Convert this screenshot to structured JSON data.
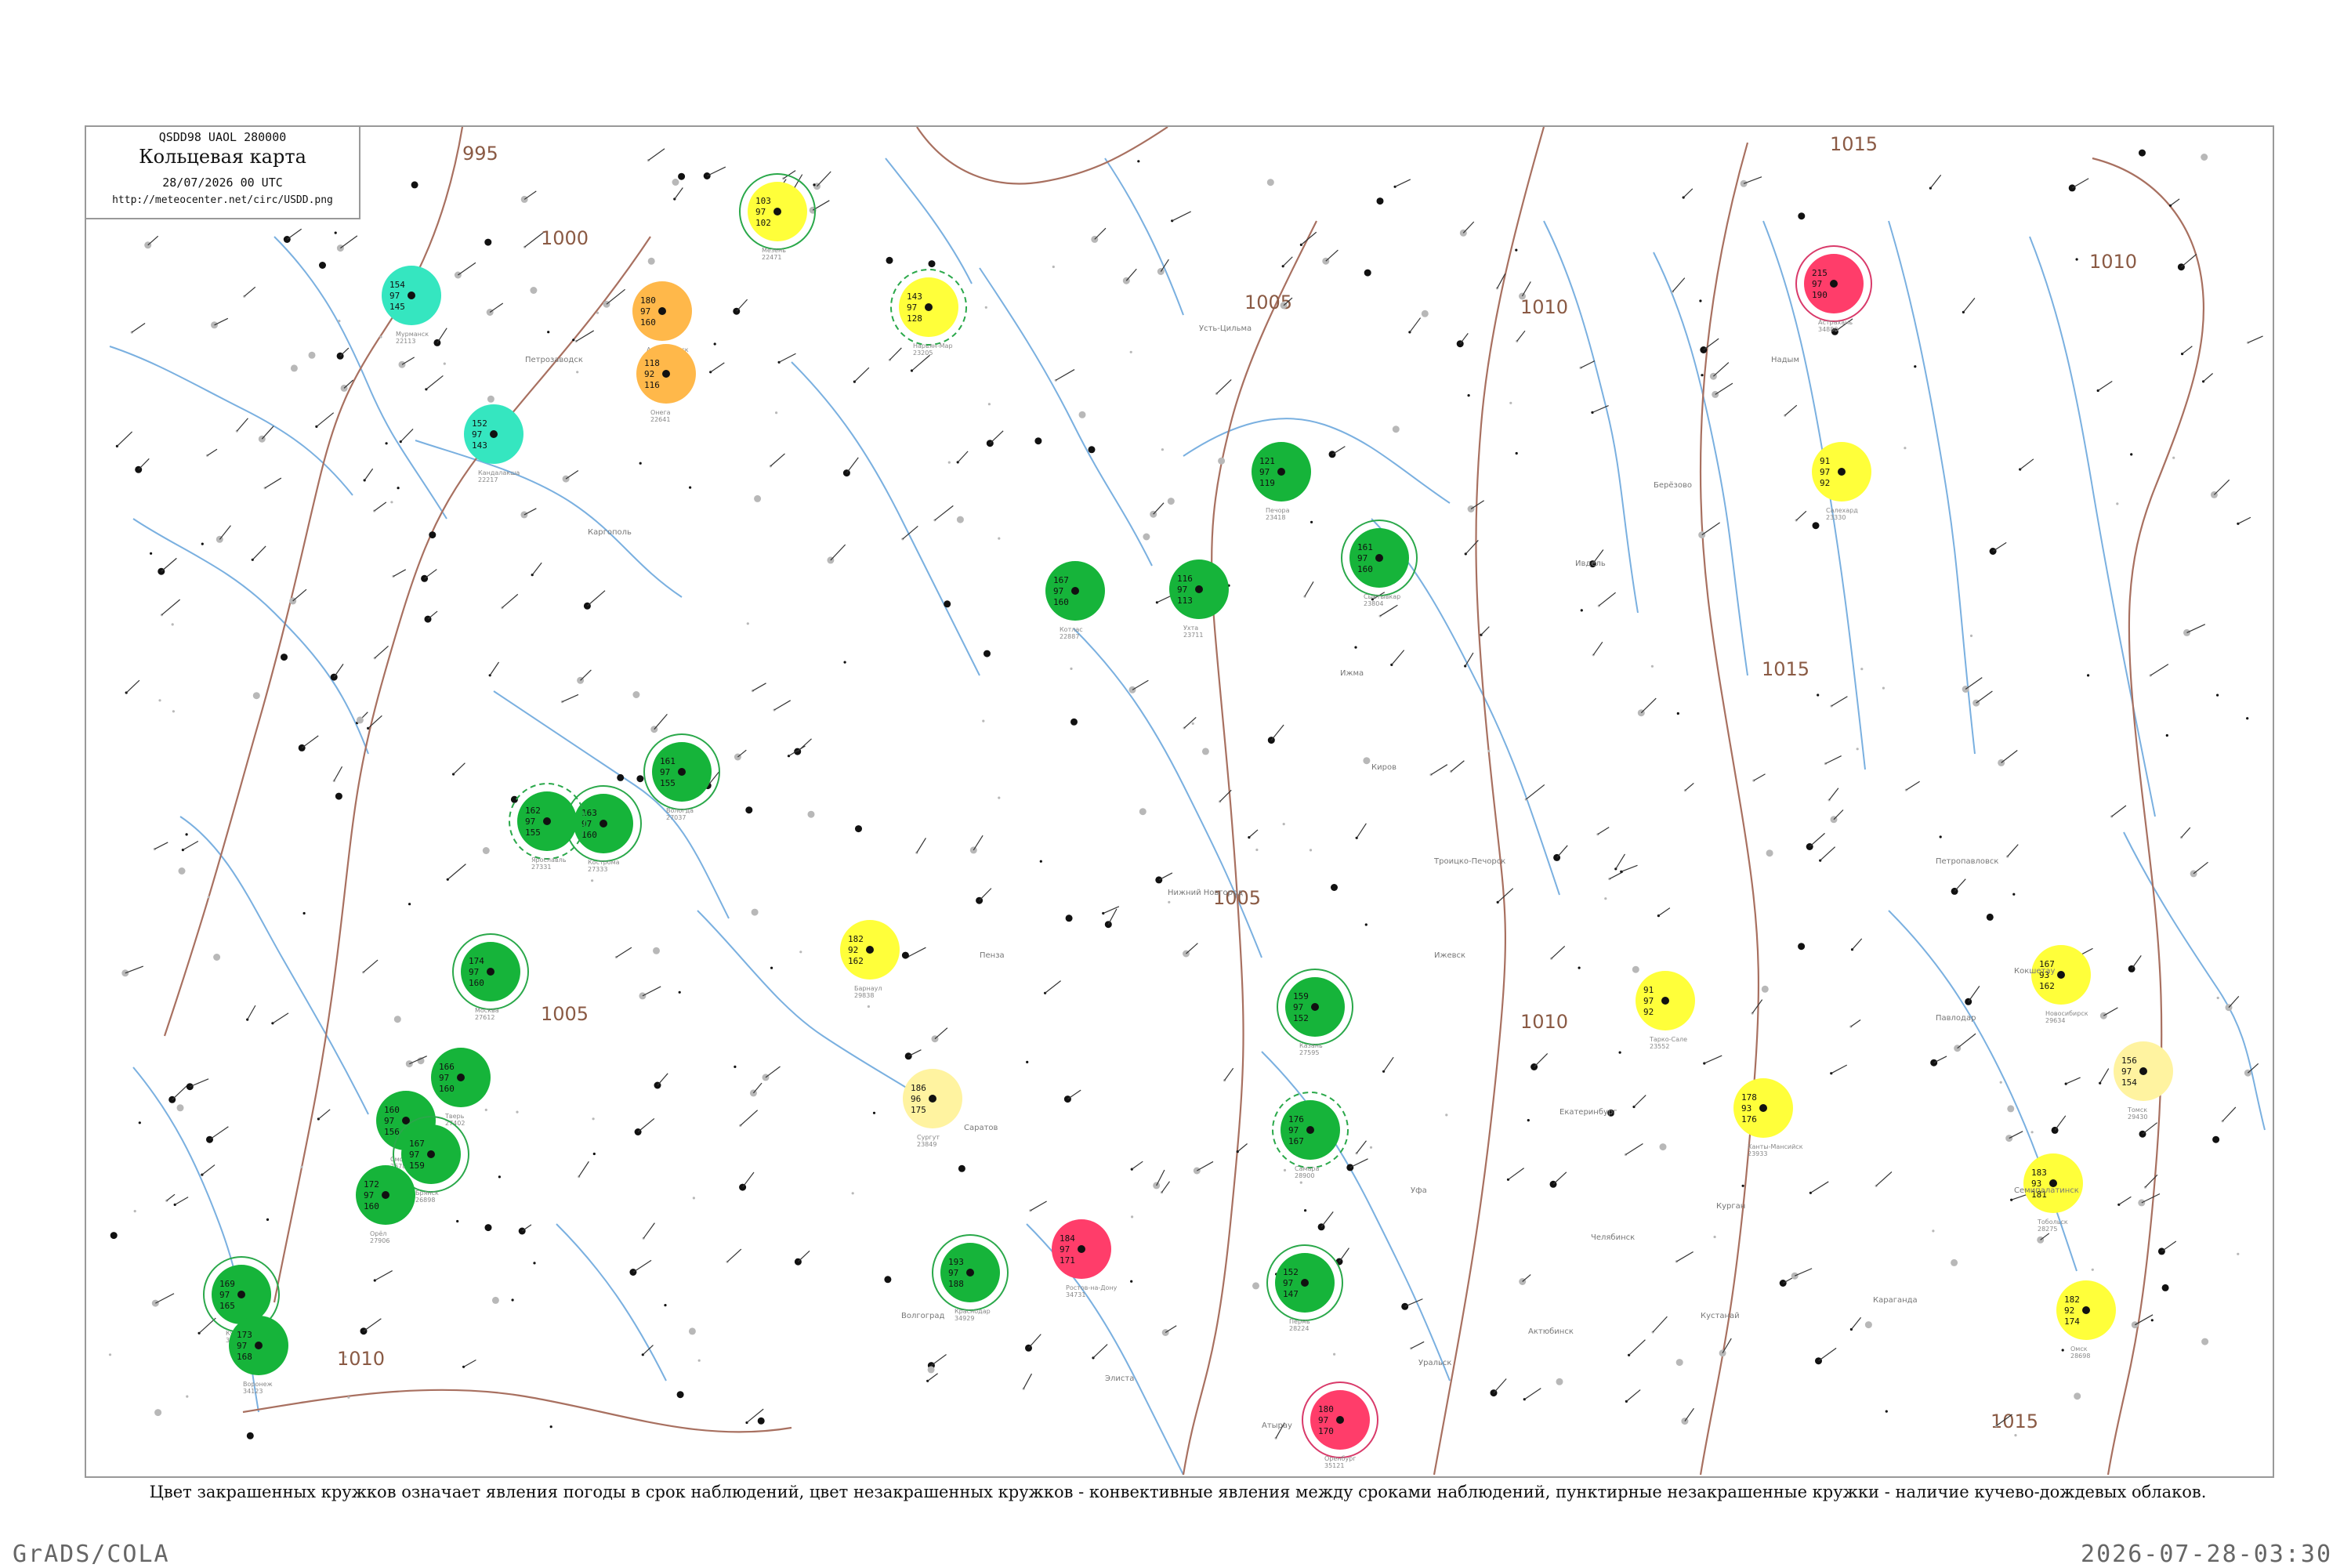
{
  "header": {
    "code_line": "QSDD98  UAOL  280000",
    "title": "Кольцевая карта",
    "date_line": "28/07/2026 00 UTC",
    "url": "http://meteocenter.net/circ/USDD.png"
  },
  "legend_caption": "Цвет закрашенных кружков означает явления погоды в срок наблюдений, цвет незакрашенных кружков - конвективные явления между сроками наблюдений, пунктирные незакрашенные кружки - наличие кучево-дождевых облаков.",
  "footer": {
    "left": "GrADS/COLA",
    "right": "2026-07-28-03:30"
  },
  "colors": {
    "isobar": "#a87060",
    "river": "#7ab0e0",
    "dot_grid": "#b8b8b8",
    "green": "#16b43a",
    "yellow": "#ffff3a",
    "pale_yellow": "#fff3a0",
    "orange": "#ffb84a",
    "red": "#ff3d6a",
    "cyan": "#35e6c0",
    "mint": "#66e6a6",
    "ring_green": "#2aa84a",
    "ring_red": "#d93a6a"
  },
  "isobars": [
    {
      "label": "995"
    },
    {
      "label": "1000"
    },
    {
      "label": "1005"
    },
    {
      "label": "1010"
    },
    {
      "label": "1015"
    }
  ],
  "stations": [
    {
      "name": "Мурманск",
      "num": "22113",
      "t": "154",
      "d": "145",
      "vis": "97",
      "fill": "cyan",
      "ring": "none"
    },
    {
      "name": "Кандалакша",
      "num": "22217",
      "t": "152",
      "d": "143",
      "vis": "97",
      "fill": "cyan",
      "ring": "none"
    },
    {
      "name": "Архангельск",
      "num": "22550",
      "t": "180",
      "d": "160",
      "vis": "97",
      "fill": "orange",
      "ring": "none"
    },
    {
      "name": "Онега",
      "num": "22641",
      "t": "118",
      "d": "116",
      "vis": "92",
      "fill": "orange",
      "ring": "none"
    },
    {
      "name": "Мезень",
      "num": "22471",
      "t": "103",
      "d": "102",
      "vis": "97",
      "fill": "yellow",
      "ring": "green"
    },
    {
      "name": "Нарьян-Мар",
      "num": "23205",
      "t": "143",
      "d": "128",
      "vis": "97",
      "fill": "yellow",
      "ring": "green-dash"
    },
    {
      "name": "Печора",
      "num": "23418",
      "t": "121",
      "d": "119",
      "vis": "97",
      "fill": "green",
      "ring": "none"
    },
    {
      "name": "Ухта",
      "num": "23711",
      "t": "116",
      "d": "113",
      "vis": "97",
      "fill": "green",
      "ring": "none"
    },
    {
      "name": "Сыктывкар",
      "num": "23804",
      "t": "161",
      "d": "160",
      "vis": "97",
      "fill": "green",
      "ring": "green"
    },
    {
      "name": "Котлас",
      "num": "22887",
      "t": "167",
      "d": "160",
      "vis": "97",
      "fill": "green",
      "ring": "none"
    },
    {
      "name": "Вологда",
      "num": "27037",
      "t": "161",
      "d": "155",
      "vis": "97",
      "fill": "green",
      "ring": "green"
    },
    {
      "name": "Кострома",
      "num": "27333",
      "t": "163",
      "d": "160",
      "vis": "97",
      "fill": "green",
      "ring": "green"
    },
    {
      "name": "Ярославль",
      "num": "27331",
      "t": "162",
      "d": "155",
      "vis": "97",
      "fill": "green",
      "ring": "green-dash"
    },
    {
      "name": "Москва",
      "num": "27612",
      "t": "174",
      "d": "160",
      "vis": "97",
      "fill": "green",
      "ring": "green"
    },
    {
      "name": "Тверь",
      "num": "27402",
      "t": "166",
      "d": "160",
      "vis": "97",
      "fill": "green",
      "ring": "none"
    },
    {
      "name": "Смоленск",
      "num": "26781",
      "t": "160",
      "d": "156",
      "vis": "97",
      "fill": "green",
      "ring": "none"
    },
    {
      "name": "Брянск",
      "num": "26898",
      "t": "167",
      "d": "159",
      "vis": "97",
      "fill": "green",
      "ring": "green"
    },
    {
      "name": "Орёл",
      "num": "27906",
      "t": "172",
      "d": "160",
      "vis": "97",
      "fill": "green",
      "ring": "none"
    },
    {
      "name": "Курск",
      "num": "34009",
      "t": "169",
      "d": "165",
      "vis": "97",
      "fill": "green",
      "ring": "green"
    },
    {
      "name": "Воронеж",
      "num": "34123",
      "t": "173",
      "d": "168",
      "vis": "97",
      "fill": "green",
      "ring": "none"
    },
    {
      "name": "Ростов-на-Дону",
      "num": "34731",
      "t": "184",
      "d": "171",
      "vis": "97",
      "fill": "red",
      "ring": "none"
    },
    {
      "name": "Краснодар",
      "num": "34929",
      "t": "193",
      "d": "188",
      "vis": "97",
      "fill": "green",
      "ring": "green"
    },
    {
      "name": "Самара",
      "num": "28900",
      "t": "176",
      "d": "167",
      "vis": "97",
      "fill": "green",
      "ring": "green-dash"
    },
    {
      "name": "Казань",
      "num": "27595",
      "t": "159",
      "d": "152",
      "vis": "97",
      "fill": "green",
      "ring": "green"
    },
    {
      "name": "Пермь",
      "num": "28224",
      "t": "152",
      "d": "147",
      "vis": "97",
      "fill": "green",
      "ring": "green"
    },
    {
      "name": "Оренбург",
      "num": "35121",
      "t": "180",
      "d": "170",
      "vis": "97",
      "fill": "red",
      "ring": "red"
    },
    {
      "name": "Астрахань",
      "num": "34880",
      "t": "215",
      "d": "190",
      "vis": "97",
      "fill": "red",
      "ring": "red"
    },
    {
      "name": "Салехард",
      "num": "23330",
      "t": "91",
      "d": "92",
      "vis": "97",
      "fill": "yellow",
      "ring": "none"
    },
    {
      "name": "Тарко-Сале",
      "num": "23552",
      "t": "91",
      "d": "92",
      "vis": "97",
      "fill": "yellow",
      "ring": "none"
    },
    {
      "name": "Ханты-Мансийск",
      "num": "23933",
      "t": "178",
      "d": "176",
      "vis": "93",
      "fill": "yellow",
      "ring": "none"
    },
    {
      "name": "Тобольск",
      "num": "28275",
      "t": "183",
      "d": "181",
      "vis": "93",
      "fill": "yellow",
      "ring": "none"
    },
    {
      "name": "Омск",
      "num": "28698",
      "t": "182",
      "d": "174",
      "vis": "92",
      "fill": "yellow",
      "ring": "none"
    },
    {
      "name": "Новосибирск",
      "num": "29634",
      "t": "167",
      "d": "162",
      "vis": "93",
      "fill": "yellow",
      "ring": "none"
    },
    {
      "name": "Барнаул",
      "num": "29838",
      "t": "182",
      "d": "162",
      "vis": "92",
      "fill": "yellow",
      "ring": "none"
    },
    {
      "name": "Сургут",
      "num": "23849",
      "t": "186",
      "d": "175",
      "vis": "96",
      "fill": "pale_yellow",
      "ring": "none"
    },
    {
      "name": "Томск",
      "num": "29430",
      "t": "156",
      "d": "154",
      "vis": "97",
      "fill": "pale_yellow",
      "ring": "none"
    }
  ],
  "place_names": [
    {
      "label": "Каргополь"
    },
    {
      "label": "Петрозаводск"
    },
    {
      "label": "Усть-Цильма"
    },
    {
      "label": "Ижма"
    },
    {
      "label": "Троицко-Печорск"
    },
    {
      "label": "Ивдель"
    },
    {
      "label": "Берёзово"
    },
    {
      "label": "Надым"
    },
    {
      "label": "Екатеринбург"
    },
    {
      "label": "Курган"
    },
    {
      "label": "Челябинск"
    },
    {
      "label": "Уфа"
    },
    {
      "label": "Ижевск"
    },
    {
      "label": "Киров"
    },
    {
      "label": "Нижний Новгород"
    },
    {
      "label": "Пенза"
    },
    {
      "label": "Саратов"
    },
    {
      "label": "Волгоград"
    },
    {
      "label": "Элиста"
    },
    {
      "label": "Павлодар"
    },
    {
      "label": "Семипалатинск"
    },
    {
      "label": "Караганда"
    },
    {
      "label": "Кустанай"
    },
    {
      "label": "Актюбинск"
    },
    {
      "label": "Уральск"
    },
    {
      "label": "Атырау"
    },
    {
      "label": "Петропавловск"
    },
    {
      "label": "Кокшетау"
    }
  ]
}
